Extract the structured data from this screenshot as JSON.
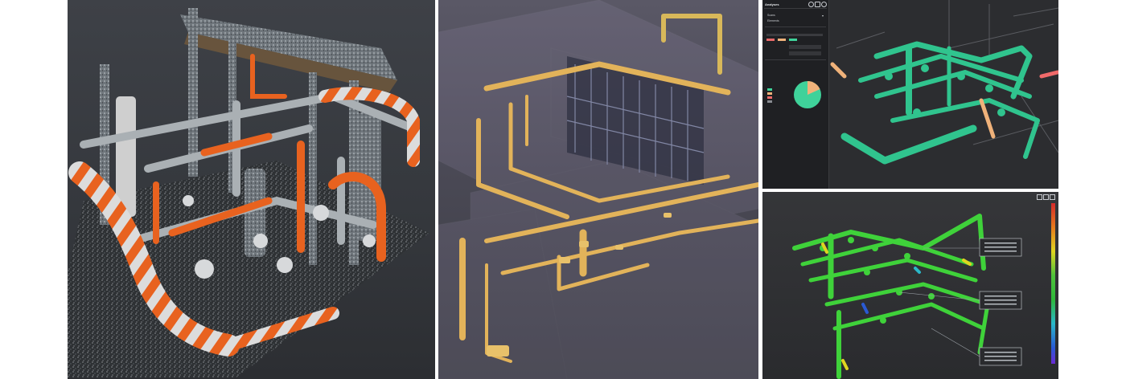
{
  "panel3": {
    "ui_title": "Analyses",
    "rows": [
      {
        "label": "Scans",
        "value": ""
      },
      {
        "label": "Elements",
        "value": ""
      }
    ],
    "chart_legend": [
      {
        "label": "",
        "color": "#3fd29a"
      },
      {
        "label": "",
        "color": "#f0b27a"
      },
      {
        "label": "",
        "color": "#f06a6a"
      },
      {
        "label": "",
        "color": "#8a8d93"
      }
    ],
    "pie_colors": [
      "#3fd29a",
      "#f0b27a"
    ],
    "pie_fraction": 0.82
  },
  "colors": {
    "pipe_orange": "#e8621f",
    "pipe_gold": "#e2b35a",
    "pipe_teal": "#30c48e",
    "pipe_green": "#3fd23a"
  },
  "icons": [
    "home-icon",
    "share-icon",
    "help-icon",
    "dropdown-icon"
  ]
}
